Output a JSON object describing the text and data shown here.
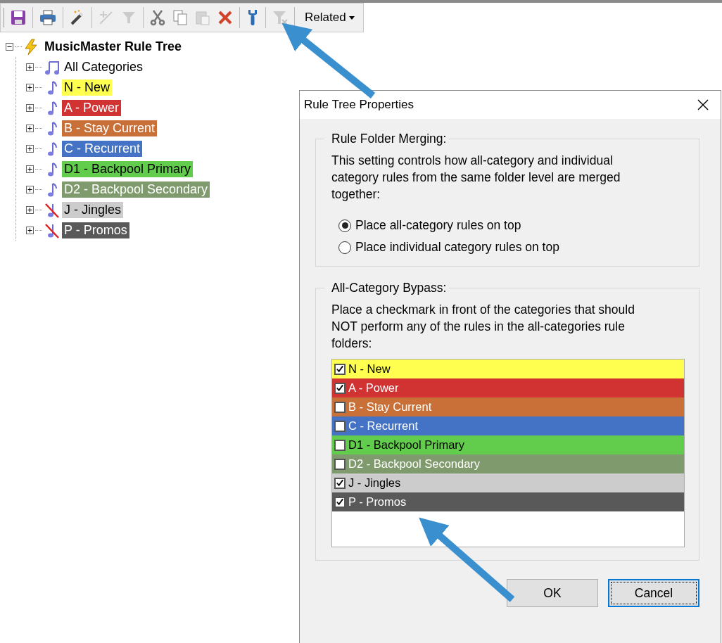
{
  "toolbar": {
    "items": [
      {
        "kind": "save",
        "disabled": false
      },
      {
        "kind": "print",
        "disabled": false
      },
      {
        "kind": "wand",
        "disabled": false
      },
      {
        "kind": "sparkle",
        "disabled": true
      },
      {
        "kind": "sparkle-funnel",
        "disabled": true
      },
      {
        "kind": "cut",
        "disabled": false
      },
      {
        "kind": "copy",
        "disabled": false
      },
      {
        "kind": "paste",
        "disabled": true
      },
      {
        "kind": "delete",
        "disabled": false
      },
      {
        "kind": "wrench",
        "disabled": false
      },
      {
        "kind": "clear-filter",
        "disabled": true
      }
    ],
    "related": "Related"
  },
  "tree": {
    "title": "MusicMaster Rule Tree",
    "expanded": true,
    "children": [
      {
        "label": "All Categories",
        "kind": "all"
      },
      {
        "label": "N - New",
        "kind": "music",
        "color": "#ffff50"
      },
      {
        "label": "A - Power",
        "kind": "music",
        "color": "#d13232"
      },
      {
        "label": "B - Stay Current",
        "kind": "music",
        "color": "#c87038"
      },
      {
        "label": "C - Recurrent",
        "kind": "music",
        "color": "#4472c4"
      },
      {
        "label": "D1 - Backpool Primary",
        "kind": "music",
        "color": "#62cc4c"
      },
      {
        "label": "D2 - Backpool Secondary",
        "kind": "music",
        "color": "#7f9a6c"
      },
      {
        "label": "J - Jingles",
        "kind": "excluded",
        "color": "#cccccc"
      },
      {
        "label": "P - Promos",
        "kind": "excluded",
        "color": "#595959"
      }
    ]
  },
  "dialog": {
    "title": "Rule Tree Properties",
    "merging": {
      "legend": "Rule Folder Merging:",
      "description": "This setting controls how all-category and individual category rules from the same folder level are merged together:",
      "options": [
        {
          "label": "Place all-category rules on top",
          "selected": true
        },
        {
          "label": "Place individual category rules on top",
          "selected": false
        }
      ]
    },
    "bypass": {
      "legend": "All-Category Bypass:",
      "description": "Place a checkmark in front of the categories that should NOT perform any of the rules in the all-categories rule folders:",
      "categories": [
        {
          "label": "N - New",
          "checked": true,
          "color": "#ffff50"
        },
        {
          "label": "A - Power",
          "checked": true,
          "color": "#d13232"
        },
        {
          "label": "B - Stay Current",
          "checked": false,
          "color": "#c87038"
        },
        {
          "label": "C - Recurrent",
          "checked": false,
          "color": "#4472c4"
        },
        {
          "label": "D1 - Backpool Primary",
          "checked": false,
          "color": "#62cc4c"
        },
        {
          "label": "D2 - Backpool Secondary",
          "checked": false,
          "color": "#7f9a6c"
        },
        {
          "label": "J - Jingles",
          "checked": true,
          "color": "#cccccc"
        },
        {
          "label": "P - Promos",
          "checked": true,
          "color": "#595959"
        }
      ]
    },
    "buttons": [
      {
        "label": "OK",
        "focused": false
      },
      {
        "label": "Cancel",
        "focused": true
      }
    ]
  }
}
